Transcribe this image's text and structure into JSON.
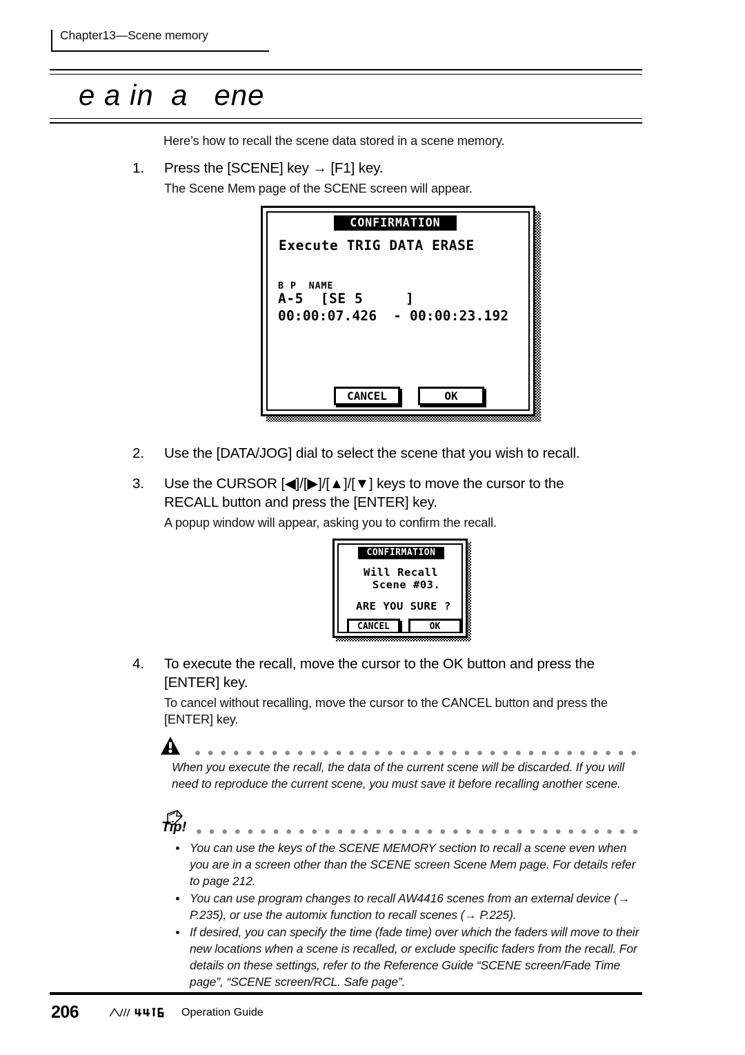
{
  "header": {
    "chapter": "Chapter13—Scene memory"
  },
  "title": {
    "heading": "e a in  a   ene"
  },
  "intro": "Here’s how to recall the scene data stored in a scene memory.",
  "steps": [
    {
      "num": "1.",
      "text": "Press the [SCENE] key → [F1] key.",
      "note": "The Scene Mem page of the SCENE screen will appear."
    },
    {
      "num": "2.",
      "text": "Use the [DATA/JOG] dial to select the scene that you wish to recall.",
      "note": ""
    },
    {
      "num": "3.",
      "text": "Use the CURSOR [◀]/[▶]/[▲]/[▼] keys to move the cursor to the RECALL button and press the [ENTER] key.",
      "note": "A popup window will appear, asking you to confirm the recall."
    },
    {
      "num": "4.",
      "text": "To execute the recall, move the cursor to the OK button and press the [ENTER] key.",
      "note": "To cancel without recalling, move the cursor to the CANCEL button and press the [ENTER] key."
    }
  ],
  "lcd_main": {
    "titlebar": "CONFIRMATION",
    "line1": "Execute TRIG DATA ERASE",
    "line2": "B P  NAME",
    "line3": "A-5  [SE 5     ]",
    "line4": "00:00:07.426  - 00:00:23.192",
    "cancel_label": "CANCEL",
    "ok_label": "OK"
  },
  "lcd_popup": {
    "titlebar": "CONFIRMATION",
    "line1": "Will Recall",
    "line2": "Scene #03.",
    "line3": "ARE YOU SURE ?",
    "cancel_label": "CANCEL",
    "ok_label": "OK"
  },
  "warning": {
    "icon": "warning-triangle-icon",
    "text": "When you execute the recall, the data of the current scene will be discarded. If you will need to reproduce the current scene, you must save it before recalling another scene."
  },
  "tip": {
    "icon": "tip-pencil-icon",
    "label": "Tip!",
    "bullets": [
      "You can use the keys of the SCENE MEMORY section to recall a scene even when you are in a screen other than the SCENE screen Scene Mem page. For details refer to page 212.",
      "You can use program changes to recall AW4416 scenes from an external device (→ P.235), or use the automix function to recall scenes (→ P.225).",
      "If desired, you can specify the time (fade time) over which the faders will move to their new locations when a scene is recalled, or exclude specific faders from the recall. For details on these settings, refer to the Reference Guide “SCENE screen/Fade Time page”, “SCENE screen/RCL. Safe page”."
    ]
  },
  "footer": {
    "page_number": "206",
    "product": "AW4416",
    "guide_label": "Operation Guide"
  },
  "colors": {
    "ink": "#000000",
    "dot_rule": "#8a8a8a"
  }
}
